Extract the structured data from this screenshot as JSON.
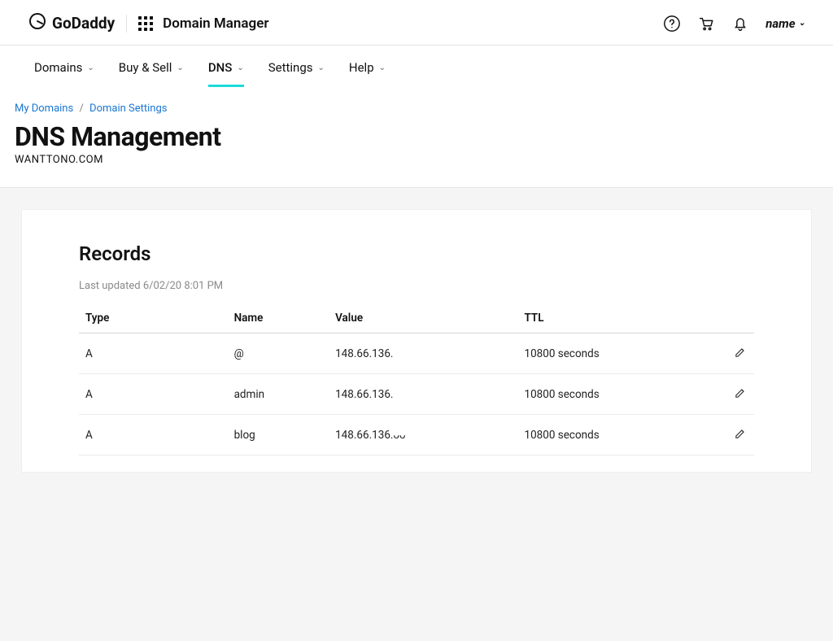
{
  "brand": {
    "name": "GoDaddy",
    "app_title": "Domain Manager"
  },
  "user": {
    "label": "name"
  },
  "nav": {
    "items": [
      {
        "label": "Domains",
        "active": false
      },
      {
        "label": "Buy & Sell",
        "active": false
      },
      {
        "label": "DNS",
        "active": true
      },
      {
        "label": "Settings",
        "active": false
      },
      {
        "label": "Help",
        "active": false
      }
    ]
  },
  "breadcrumb": {
    "items": [
      {
        "label": "My Domains"
      },
      {
        "label": "Domain Settings"
      }
    ]
  },
  "page": {
    "title": "DNS Management",
    "domain": "WANTTONO.COM"
  },
  "records": {
    "title": "Records",
    "last_updated": "Last updated 6/02/20 8:01 PM",
    "columns": {
      "type": "Type",
      "name": "Name",
      "value": "Value",
      "ttl": "TTL"
    },
    "rows": [
      {
        "type": "A",
        "name": "@",
        "value": "148.66.136.",
        "ttl": "10800 seconds"
      },
      {
        "type": "A",
        "name": "admin",
        "value": "148.66.136.",
        "ttl": "10800 seconds"
      },
      {
        "type": "A",
        "name": "blog",
        "value": "148.66.136.ᴗᴗ",
        "ttl": "10800 seconds"
      }
    ]
  }
}
